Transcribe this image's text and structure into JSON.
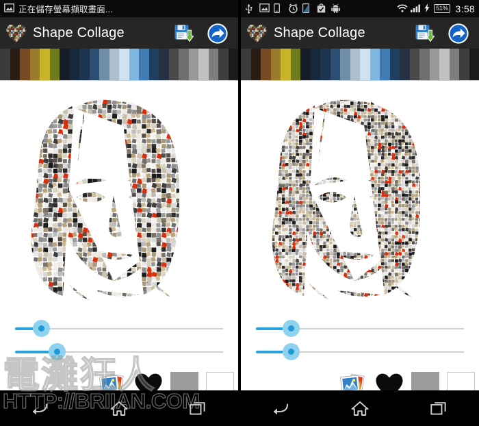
{
  "panels": [
    {
      "id": "left",
      "statusbar": {
        "notification_icon": "image-icon",
        "notification_text": "正在儲存螢幕擷取畫面...",
        "icons": [],
        "clock": "",
        "battery": ""
      },
      "appbar": {
        "logo_icon": "heart-collage-logo",
        "title": "Shape Collage",
        "save_icon": "floppy-save-icon",
        "share_icon": "share-arrow-icon"
      },
      "filmstrip": {
        "name": "source-photos-strip",
        "cell_colors": [
          "#3a3a3a",
          "#2a1c12",
          "#7a4a22",
          "#9c7c2c",
          "#c8b42a",
          "#6f7a1c",
          "#141d28",
          "#17283a",
          "#1d3550",
          "#2c4e73",
          "#6f8da8",
          "#aebfcd",
          "#cfe2f0",
          "#7fb6e0",
          "#3f7cb4",
          "#1d3f60",
          "#253244",
          "#4a4a4a",
          "#6e6e6e",
          "#9a9a9a",
          "#c2c2c2",
          "#7d7d7d",
          "#3d3d3d",
          "#1c1c1c"
        ]
      },
      "collage": {
        "name": "collage-preview",
        "shape": "face-portrait",
        "tile_size": 7.2,
        "tile_count_scale": "coarse",
        "background": "#ffffff"
      },
      "sliders": [
        {
          "name": "tile-size-slider",
          "value_pct": 12
        },
        {
          "name": "tile-count-slider",
          "value_pct": 19
        }
      ],
      "toolbar": {
        "photos_label": "photos-icon",
        "shape_label": "heart-shape-icon",
        "color_gray": "#9c9c9c",
        "color_white": "#ffffff"
      },
      "navbar": {
        "back": "back-icon",
        "home": "home-icon",
        "recents": "recents-icon"
      },
      "watermark": {
        "cjk": "電灘狂人",
        "url": "HTTP://BRIIAN.COM",
        "visible": true
      }
    },
    {
      "id": "right",
      "statusbar": {
        "notification_icon": "",
        "notification_text": "",
        "icons": [
          "usb-icon",
          "image-icon",
          "device-icon",
          "alarm-icon",
          "screen-icon",
          "shopping-bag-check-icon",
          "android-icon"
        ],
        "wifi_icon": "wifi-icon",
        "signal_icon": "signal-bars-icon",
        "charging_icon": "charging-bolt-icon",
        "battery": "51%",
        "clock": "3:58"
      },
      "appbar": {
        "logo_icon": "heart-collage-logo",
        "title": "Shape Collage",
        "save_icon": "floppy-save-icon",
        "share_icon": "share-arrow-icon"
      },
      "filmstrip": {
        "name": "source-photos-strip",
        "cell_colors": [
          "#3a3a3a",
          "#2a1c12",
          "#7a4a22",
          "#9c7c2c",
          "#c8b42a",
          "#6f7a1c",
          "#141d28",
          "#17283a",
          "#1d3550",
          "#2c4e73",
          "#6f8da8",
          "#aebfcd",
          "#cfe2f0",
          "#7fb6e0",
          "#3f7cb4",
          "#1d3f60",
          "#253244",
          "#4a4a4a",
          "#6e6e6e",
          "#9a9a9a",
          "#c2c2c2",
          "#7d7d7d",
          "#3d3d3d",
          "#1c1c1c"
        ]
      },
      "collage": {
        "name": "collage-preview",
        "shape": "face-portrait",
        "tile_size": 5.0,
        "tile_count_scale": "fine",
        "background": "#ffffff"
      },
      "sliders": [
        {
          "name": "tile-size-slider",
          "value_pct": 16
        },
        {
          "name": "tile-count-slider",
          "value_pct": 16
        }
      ],
      "toolbar": {
        "photos_label": "photos-icon",
        "shape_label": "heart-shape-icon",
        "color_gray": "#9c9c9c",
        "color_white": "#ffffff"
      },
      "navbar": {
        "back": "back-icon",
        "home": "home-icon",
        "recents": "recents-icon"
      },
      "watermark": {
        "cjk": "",
        "url": "",
        "visible": false
      }
    }
  ],
  "theme": {
    "appbar_bg": "#262626",
    "statusbar_bg": "#0b0b0b",
    "slider_accent": "#29a3dc",
    "slider_halo": "#8ed2ef",
    "canvas_bg": "#ffffff",
    "nav_bg": "#000000"
  }
}
